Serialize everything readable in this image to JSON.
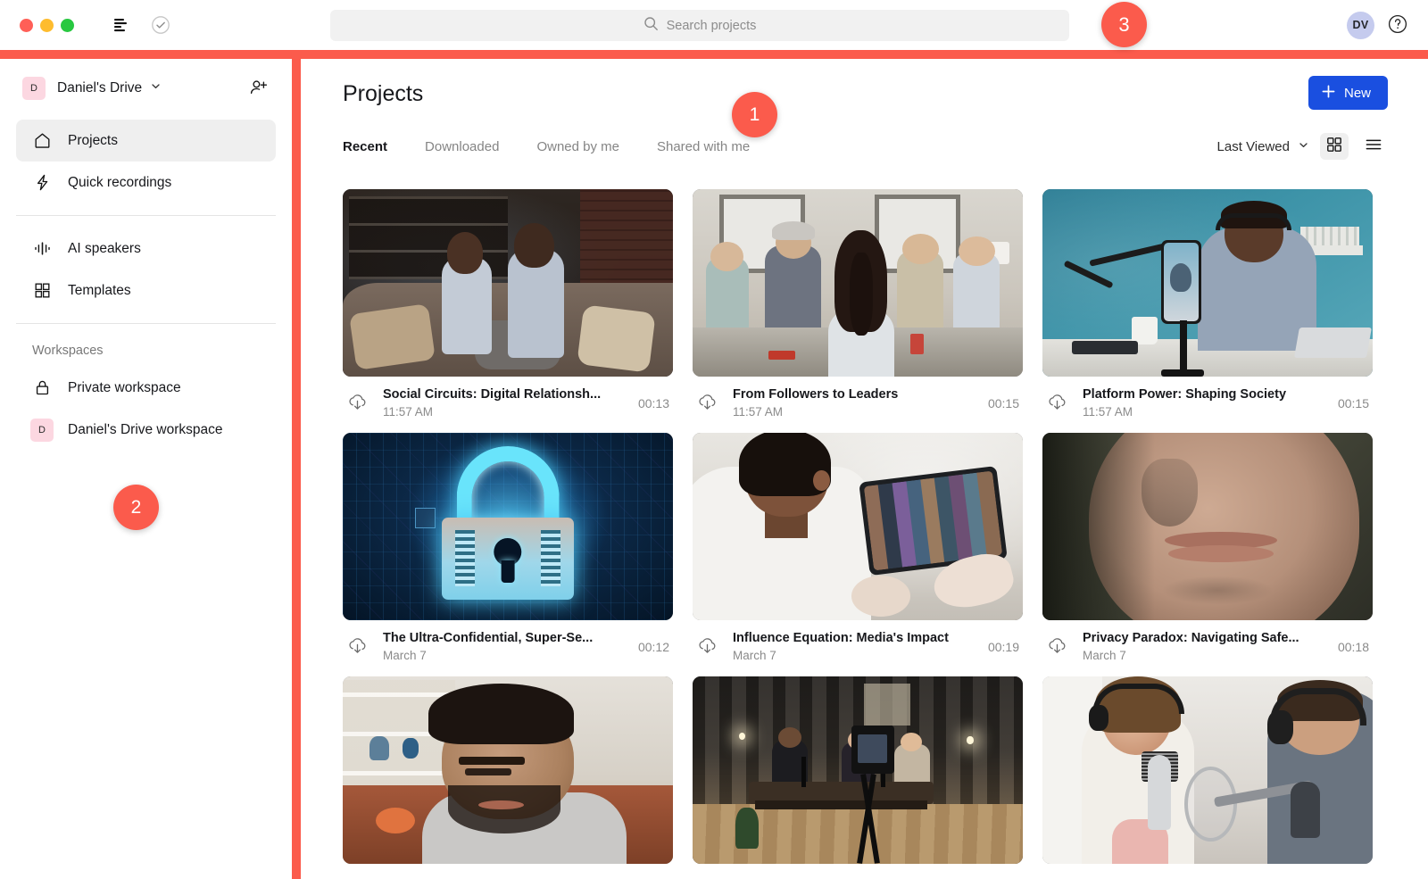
{
  "window": {
    "traffic_lights": [
      "close",
      "minimize",
      "maximize"
    ],
    "toolbar_icons": [
      "panel-toggle-icon",
      "check-circle-icon"
    ]
  },
  "search": {
    "placeholder": "Search projects",
    "icon": "search-icon",
    "value": ""
  },
  "account": {
    "avatar_initials": "DV",
    "avatar_bg": "#c5cbee",
    "help_icon": "help-circle-icon"
  },
  "sidebar": {
    "drive": {
      "badge": "D",
      "badge_bg": "#fcd7e1",
      "name": "Daniel's Drive",
      "chevron": "chevron-down-icon",
      "invite_icon": "add-person-icon"
    },
    "nav": [
      {
        "label": "Projects",
        "icon": "home-icon",
        "active": true
      },
      {
        "label": "Quick recordings",
        "icon": "lightning-icon",
        "active": false
      }
    ],
    "nav2": [
      {
        "label": "AI speakers",
        "icon": "waveform-icon",
        "active": false
      },
      {
        "label": "Templates",
        "icon": "grid-squares-icon",
        "active": false
      }
    ],
    "workspaces_label": "Workspaces",
    "workspaces": [
      {
        "label": "Private workspace",
        "icon": "lock-icon",
        "badge": null
      },
      {
        "label": "Daniel's Drive workspace",
        "icon": null,
        "badge": "D"
      }
    ]
  },
  "main": {
    "title": "Projects",
    "tabs": [
      {
        "label": "Recent",
        "active": true
      },
      {
        "label": "Downloaded",
        "active": false
      },
      {
        "label": "Owned by me",
        "active": false
      },
      {
        "label": "Shared with me",
        "active": false
      }
    ],
    "sort": {
      "label": "Last Viewed",
      "icon": "chevron-down-icon"
    },
    "views": [
      {
        "name": "grid-view",
        "icon": "grid-view-icon",
        "active": true
      },
      {
        "name": "list-view",
        "icon": "list-view-icon",
        "active": false
      }
    ],
    "new_button": {
      "label": "New",
      "icon": "plus-icon",
      "color": "#1a4fe0"
    }
  },
  "projects": [
    {
      "title": "Social Circuits: Digital Relationsh...",
      "date": "11:57 AM",
      "duration": "00:13",
      "art": "art1",
      "download_icon": "download-cloud-icon"
    },
    {
      "title": "From Followers to Leaders",
      "date": "11:57 AM",
      "duration": "00:15",
      "art": "art2",
      "download_icon": "download-cloud-icon"
    },
    {
      "title": "Platform Power: Shaping Society",
      "date": "11:57 AM",
      "duration": "00:15",
      "art": "art3",
      "download_icon": "download-cloud-icon"
    },
    {
      "title": "The Ultra-Confidential, Super-Se...",
      "date": "March 7",
      "duration": "00:12",
      "art": "art4",
      "download_icon": "download-cloud-icon"
    },
    {
      "title": "Influence Equation: Media's Impact",
      "date": "March 7",
      "duration": "00:19",
      "art": "art5",
      "download_icon": "download-cloud-icon"
    },
    {
      "title": "Privacy Paradox: Navigating Safe...",
      "date": "March 7",
      "duration": "00:18",
      "art": "art6",
      "download_icon": "download-cloud-icon"
    }
  ],
  "projects_row3": [
    {
      "art": "art7"
    },
    {
      "art": "art8"
    },
    {
      "art": "art9"
    }
  ],
  "markers": [
    {
      "label": "1",
      "target": "main-content-area"
    },
    {
      "label": "2",
      "target": "sidebar"
    },
    {
      "label": "3",
      "target": "top-header"
    }
  ],
  "accent_colors": {
    "highlight": "#fb5b4c",
    "primary_button": "#1a4fe0"
  }
}
